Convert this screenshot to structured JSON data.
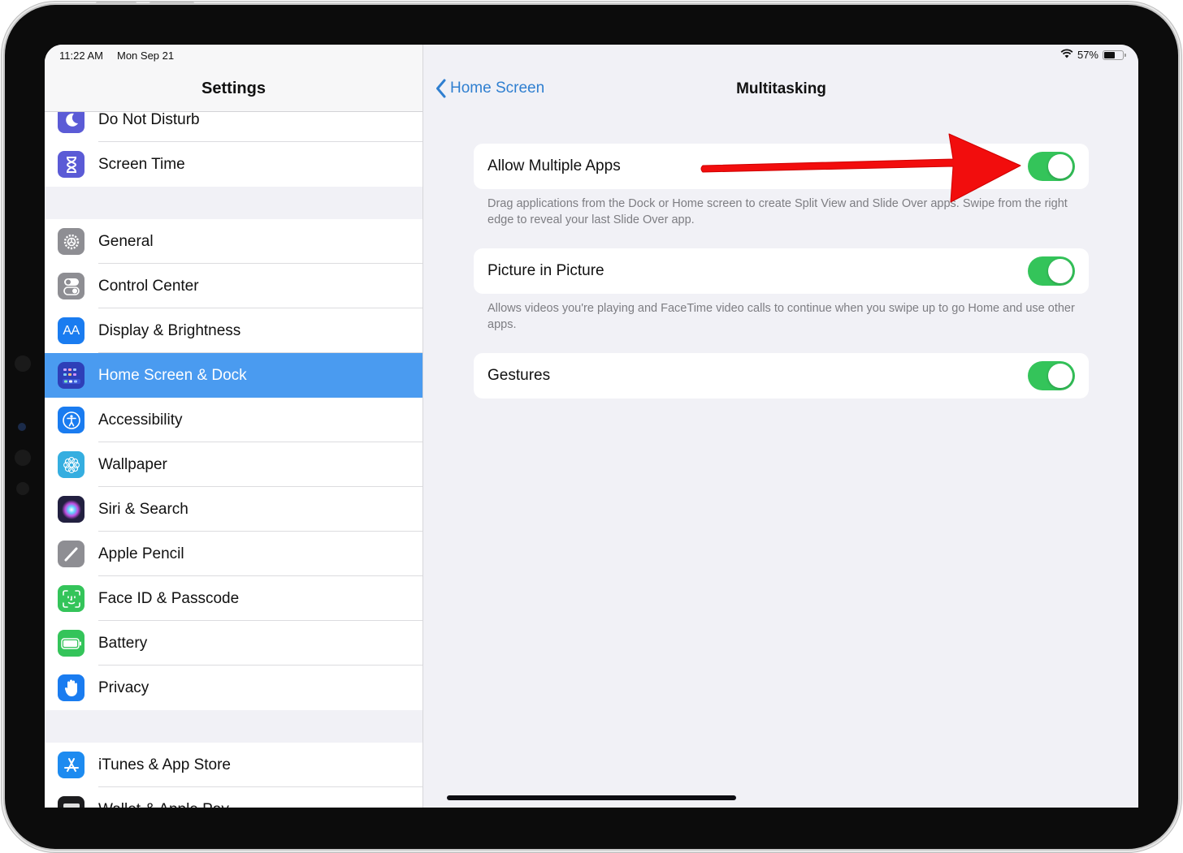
{
  "status_bar": {
    "time": "11:22 AM",
    "date": "Mon Sep 21",
    "battery_text": "57%",
    "battery_level": 0.57
  },
  "sidebar": {
    "title": "Settings",
    "groups": [
      {
        "items": [
          {
            "label": "Do Not Disturb",
            "icon": "moon-icon",
            "color": "#5b5bd6"
          },
          {
            "label": "Screen Time",
            "icon": "hourglass-icon",
            "color": "#5b5bd6"
          }
        ]
      },
      {
        "items": [
          {
            "label": "General",
            "icon": "gear-icon",
            "color": "#8e8e93"
          },
          {
            "label": "Control Center",
            "icon": "switches-icon",
            "color": "#8e8e93"
          },
          {
            "label": "Display & Brightness",
            "icon": "text-size-icon",
            "color": "#1a7cf0"
          },
          {
            "label": "Home Screen & Dock",
            "icon": "app-grid-icon",
            "color": "#2e3fb8",
            "selected": true
          },
          {
            "label": "Accessibility",
            "icon": "accessibility-icon",
            "color": "#1a7cf0"
          },
          {
            "label": "Wallpaper",
            "icon": "flower-icon",
            "color": "#35aee0"
          },
          {
            "label": "Siri & Search",
            "icon": "siri-icon",
            "color": "#222040"
          },
          {
            "label": "Apple Pencil",
            "icon": "pencil-icon",
            "color": "#8e8e93"
          },
          {
            "label": "Face ID & Passcode",
            "icon": "face-id-icon",
            "color": "#34c45a"
          },
          {
            "label": "Battery",
            "icon": "battery-icon",
            "color": "#34c45a"
          },
          {
            "label": "Privacy",
            "icon": "hand-icon",
            "color": "#1a7cf0"
          }
        ]
      },
      {
        "items": [
          {
            "label": "iTunes & App Store",
            "icon": "app-store-icon",
            "color": "#1d8bf0"
          },
          {
            "label": "Wallet & Apple Pay",
            "icon": "wallet-icon",
            "color": "#1c1c1e"
          }
        ]
      }
    ]
  },
  "detail": {
    "back_label": "Home Screen",
    "title": "Multitasking",
    "settings": [
      {
        "label": "Allow Multiple Apps",
        "on": true,
        "footnote": "Drag applications from the Dock or Home screen to create Split View and Slide Over apps. Swipe from the right edge to reveal your last Slide Over app."
      },
      {
        "label": "Picture in Picture",
        "on": true,
        "footnote": "Allows videos you're playing and FaceTime video calls to continue when you swipe up to go Home and use other apps."
      },
      {
        "label": "Gestures",
        "on": true,
        "footnote": ""
      }
    ]
  },
  "colors": {
    "accent": "#2f7fd0",
    "selection": "#4a9bf0",
    "toggle_on": "#34c45a",
    "annotation_arrow": "#f20d0d"
  }
}
